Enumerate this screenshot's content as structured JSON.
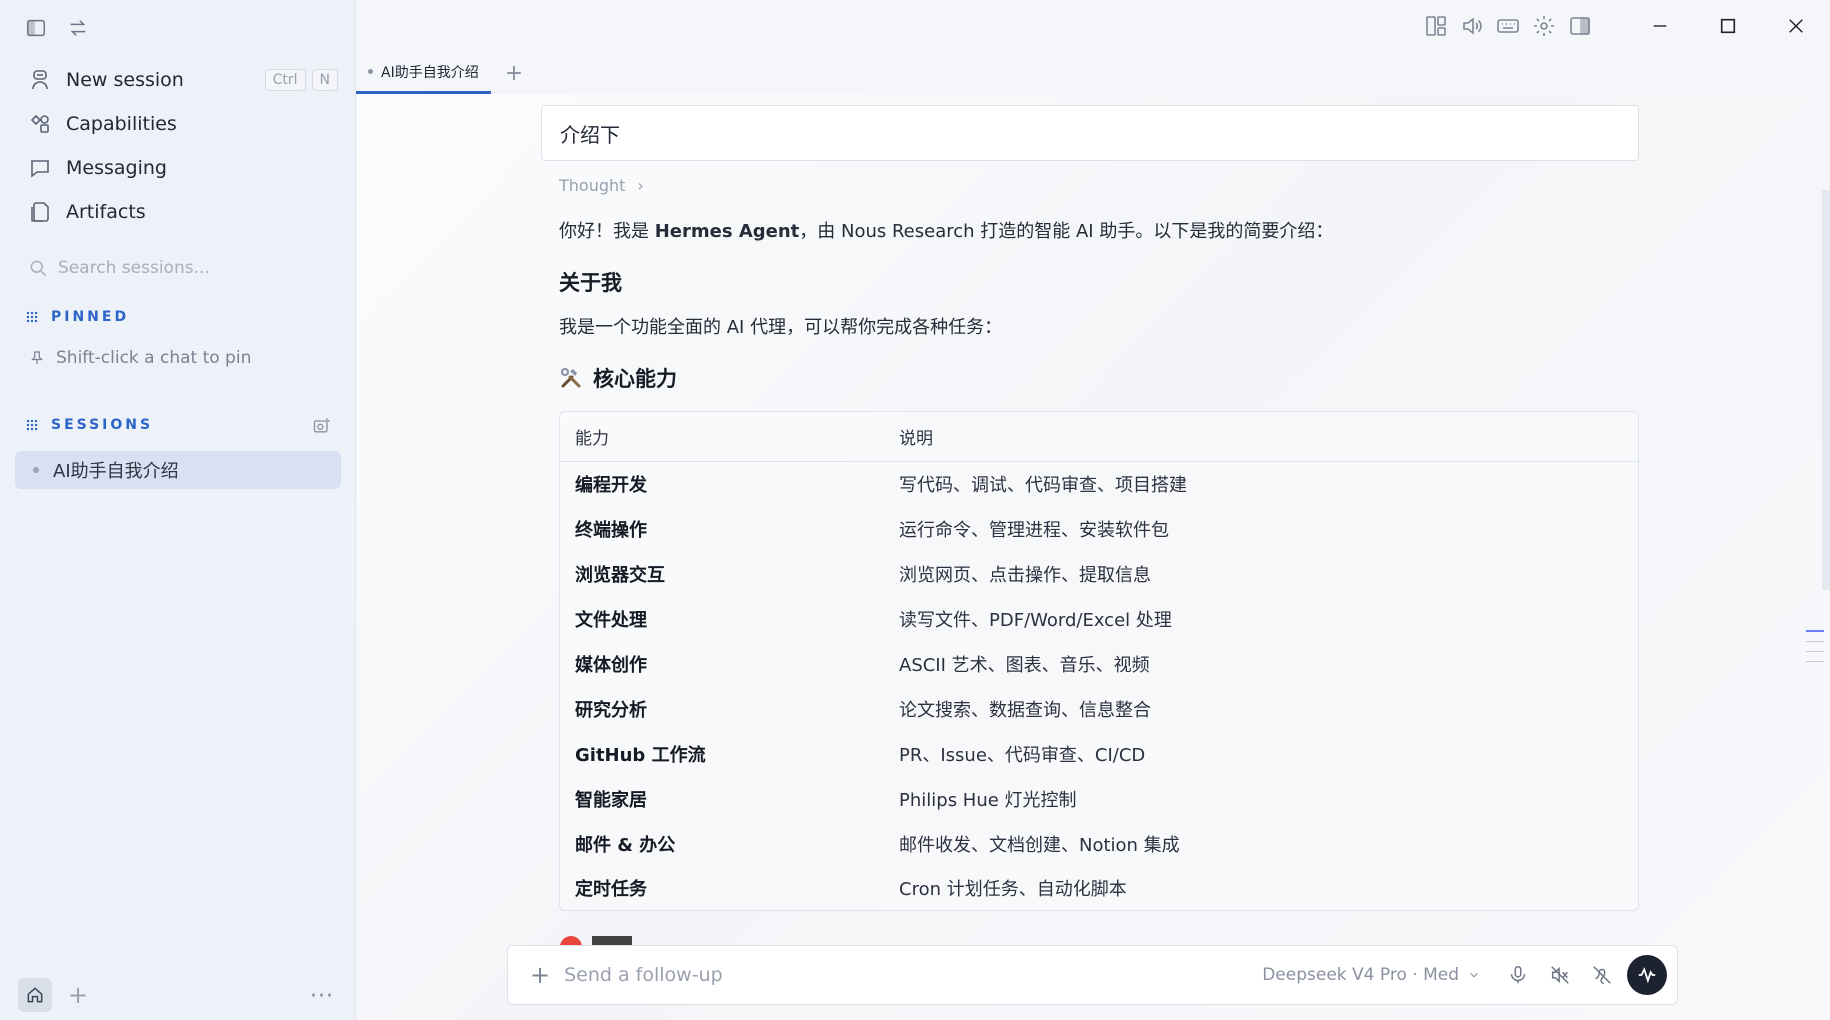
{
  "sidebar": {
    "nav": [
      {
        "label": "New session",
        "icon": "new-session-icon",
        "shortcut": [
          "Ctrl",
          "N"
        ]
      },
      {
        "label": "Capabilities",
        "icon": "capabilities-icon"
      },
      {
        "label": "Messaging",
        "icon": "messaging-icon"
      },
      {
        "label": "Artifacts",
        "icon": "artifacts-icon"
      }
    ],
    "search_placeholder": "Search sessions...",
    "pinned_label": "PINNED",
    "pin_hint": "Shift-click a chat to pin",
    "sessions_label": "SESSIONS",
    "sessions": [
      {
        "title": "AI助手自我介绍",
        "active": true
      }
    ]
  },
  "tabs": [
    {
      "label": "AI助手自我介绍",
      "active": true
    }
  ],
  "conversation": {
    "user_message": "介绍下",
    "thought_label": "Thought",
    "intro_pre": "你好！我是 ",
    "intro_bold": "Hermes Agent",
    "intro_post": "，由 Nous Research 打造的智能 AI 助手。以下是我的简要介绍：",
    "about_heading": "关于我",
    "about_text": "我是一个功能全面的 AI 代理，可以帮你完成各种任务：",
    "core_heading": "核心能力",
    "core_icon": "hammer-wrench-icon",
    "table": {
      "headers": [
        "能力",
        "说明"
      ],
      "rows": [
        [
          "编程开发",
          "写代码、调试、代码审查、项目搭建"
        ],
        [
          "终端操作",
          "运行命令、管理进程、安装软件包"
        ],
        [
          "浏览器交互",
          "浏览网页、点击操作、提取信息"
        ],
        [
          "文件处理",
          "读写文件、PDF/Word/Excel 处理"
        ],
        [
          "媒体创作",
          "ASCII 艺术、图表、音乐、视频"
        ],
        [
          "研究分析",
          "论文搜索、数据查询、信息整合"
        ],
        [
          "GitHub 工作流",
          "PR、Issue、代码审查、CI/CD"
        ],
        [
          "智能家居",
          "Philips Hue 灯光控制"
        ],
        [
          "邮件 & 办公",
          "邮件收发、文档创建、Notion 集成"
        ],
        [
          "定时任务",
          "Cron 计划任务、自动化脚本"
        ]
      ]
    }
  },
  "composer": {
    "placeholder": "Send a follow-up",
    "model": "Deepseek V4 Pro · Med"
  },
  "colors": {
    "accent": "#2c64c8",
    "sidebar_bg": "#edf1f8",
    "active_session_bg": "#d8e1f2",
    "send_button": "#1d2230"
  }
}
